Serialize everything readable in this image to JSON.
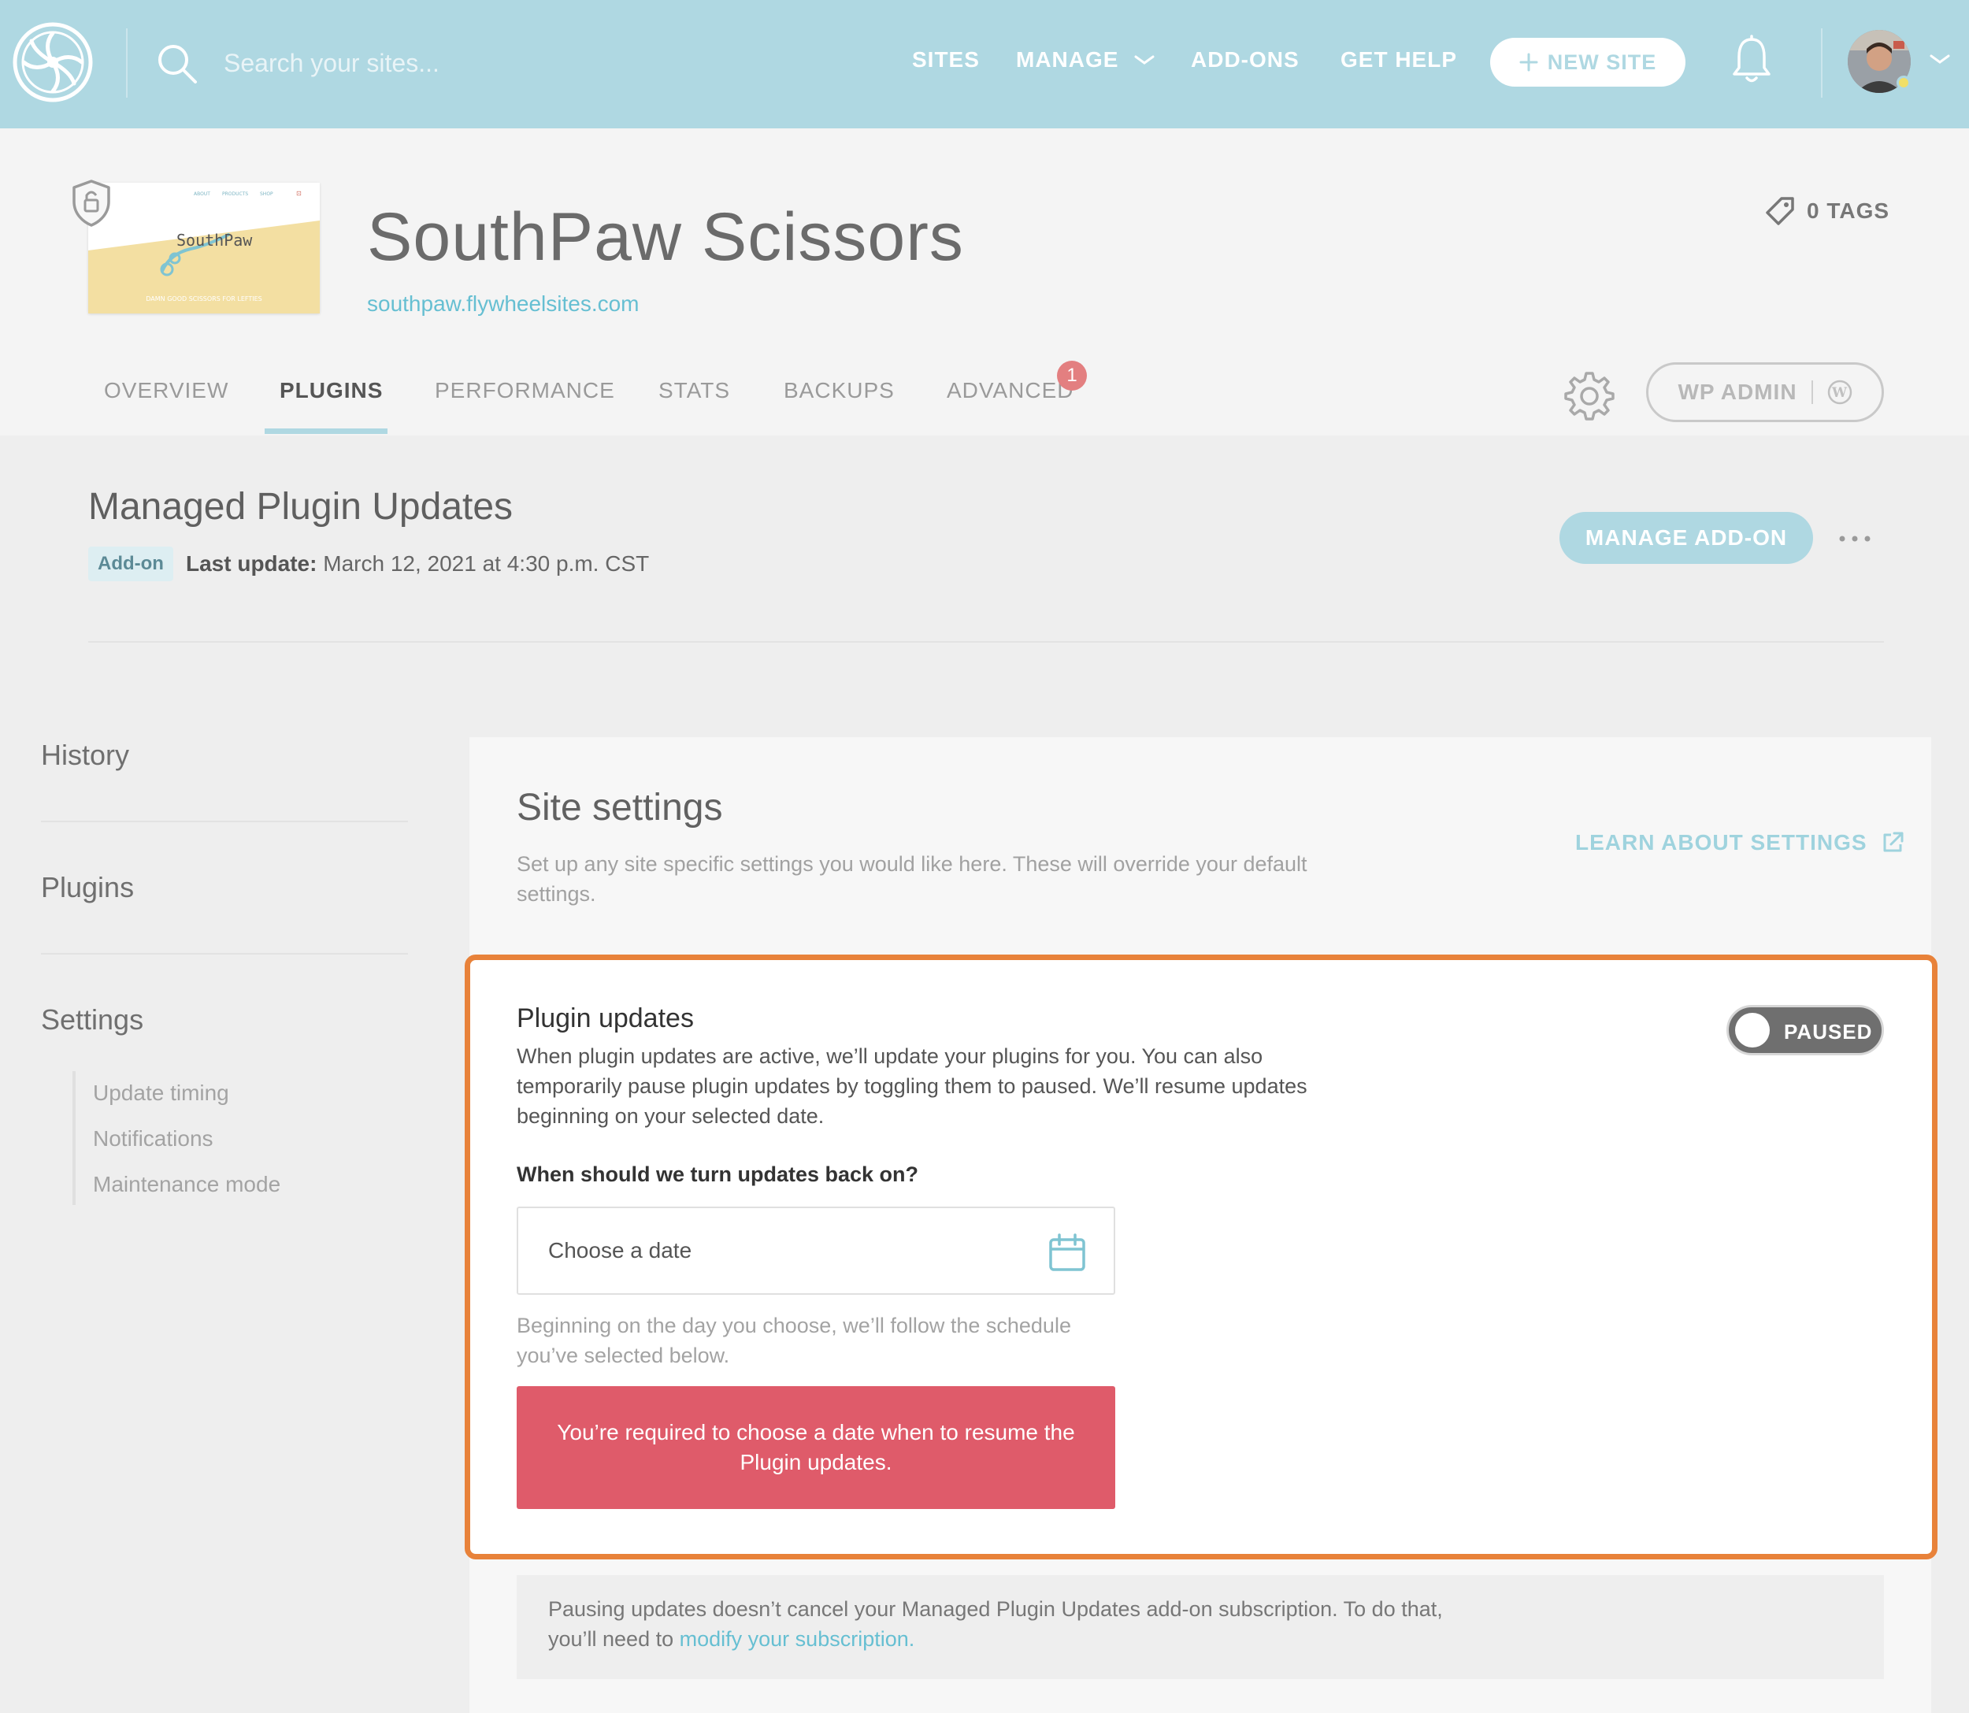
{
  "search": {
    "placeholder": "Search your sites..."
  },
  "topnav": {
    "links": [
      "SITES",
      "MANAGE",
      "ADD-ONS",
      "GET HELP"
    ],
    "new_site_label": "NEW SITE"
  },
  "site": {
    "name": "SouthPaw Scissors",
    "url": "southpaw.flywheelsites.com",
    "tags_label": "0 TAGS",
    "thumb": {
      "nav": [
        "ABOUT",
        "PRODUCTS",
        "SHOP"
      ],
      "brand": "SouthPaw",
      "tagline": "DAMN GOOD SCISSORS FOR LEFTIES"
    }
  },
  "tabs": {
    "items": [
      "OVERVIEW",
      "PLUGINS",
      "PERFORMANCE",
      "STATS",
      "BACKUPS",
      "ADVANCED"
    ],
    "active": "PLUGINS",
    "advanced_badge": "1",
    "wp_admin_label": "WP ADMIN"
  },
  "addon": {
    "title": "Managed Plugin Updates",
    "tag": "Add-on",
    "last_update_label": "Last update:",
    "last_update_value": "March 12, 2021 at 4:30 p.m. CST",
    "manage_label": "MANAGE ADD-ON"
  },
  "sidebar": {
    "items": [
      "History",
      "Plugins",
      "Settings"
    ],
    "settings_sub": [
      "Update timing",
      "Notifications",
      "Maintenance mode"
    ]
  },
  "settings": {
    "title": "Site settings",
    "description": "Set up any site specific settings you would like here. These will override your default settings.",
    "learn_label": "LEARN ABOUT SETTINGS"
  },
  "plugin_updates": {
    "title": "Plugin updates",
    "description": "When plugin updates are active, we’ll update your plugins for you. You can also temporarily pause plugin updates by toggling them to paused. We’ll resume updates beginning on your selected date.",
    "toggle_label": "PAUSED",
    "question": "When should we turn updates back on?",
    "date_placeholder": "Choose a date",
    "hint": "Beginning on the day you choose, we’ll follow the schedule you’ve selected below.",
    "error": "You’re required to choose a date when to resume the Plugin updates."
  },
  "note": {
    "text": "Pausing updates doesn’t cancel your Managed Plugin Updates add-on subscription. To do that, you’ll need to ",
    "link": "modify your subscription."
  },
  "colors": {
    "nav_bg": "#afd8e2",
    "accent_link": "#66bfd2",
    "highlight_border": "#e8823a",
    "error_bg": "#df5b6a",
    "badge": "#e37f80",
    "toggle_bg": "#6f6f6f"
  },
  "icons": [
    "flywheel-logo-icon",
    "search-icon",
    "plus-icon",
    "bell-icon",
    "chevron-down-icon",
    "shield-lock-icon",
    "tag-icon",
    "gear-icon",
    "wordpress-icon",
    "more-dots-icon",
    "external-link-icon",
    "calendar-icon"
  ]
}
